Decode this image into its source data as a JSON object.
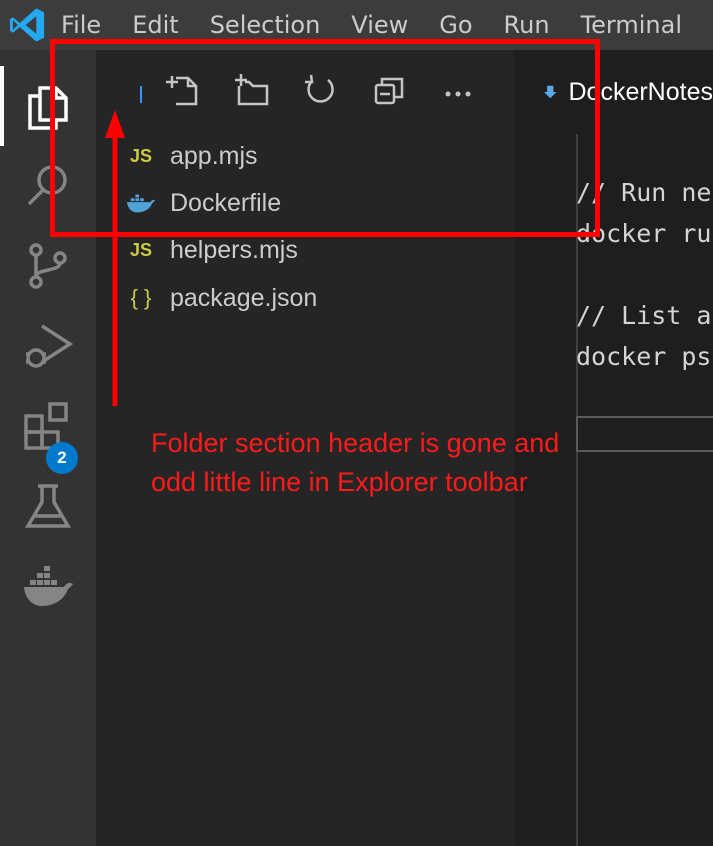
{
  "menu": {
    "items": [
      "File",
      "Edit",
      "Selection",
      "View",
      "Go",
      "Run",
      "Terminal"
    ]
  },
  "activity_bar": {
    "items": [
      {
        "icon": "files-icon",
        "active": true
      },
      {
        "icon": "search-icon"
      },
      {
        "icon": "source-control-icon"
      },
      {
        "icon": "run-debug-icon"
      },
      {
        "icon": "extensions-icon",
        "badge": "2"
      },
      {
        "icon": "testing-flask-icon"
      },
      {
        "icon": "docker-icon"
      }
    ]
  },
  "explorer": {
    "toolbar_icons": [
      "new-file-icon",
      "new-folder-icon",
      "refresh-icon",
      "collapse-all-icon",
      "more-actions-icon"
    ],
    "files": [
      {
        "name": "app.mjs",
        "icon": "JS",
        "type": "js"
      },
      {
        "name": "Dockerfile",
        "icon": "docker-whale",
        "type": "docker"
      },
      {
        "name": "helpers.mjs",
        "icon": "JS",
        "type": "js"
      },
      {
        "name": "package.json",
        "icon": "{ }",
        "type": "json"
      }
    ]
  },
  "editor": {
    "tab_label": "DockerNotes",
    "lines": [
      "// Run ne",
      "docker ru",
      "",
      "// List a",
      "docker ps"
    ]
  },
  "annotation": {
    "text": "Folder section header is gone and odd little line in Explorer toolbar",
    "color": "#ff0000"
  },
  "colors": {
    "titlebar": "#3c3c3c",
    "activitybar": "#333333",
    "sidebar": "#252526",
    "editor": "#1e1e1e",
    "accent": "#007acc"
  }
}
